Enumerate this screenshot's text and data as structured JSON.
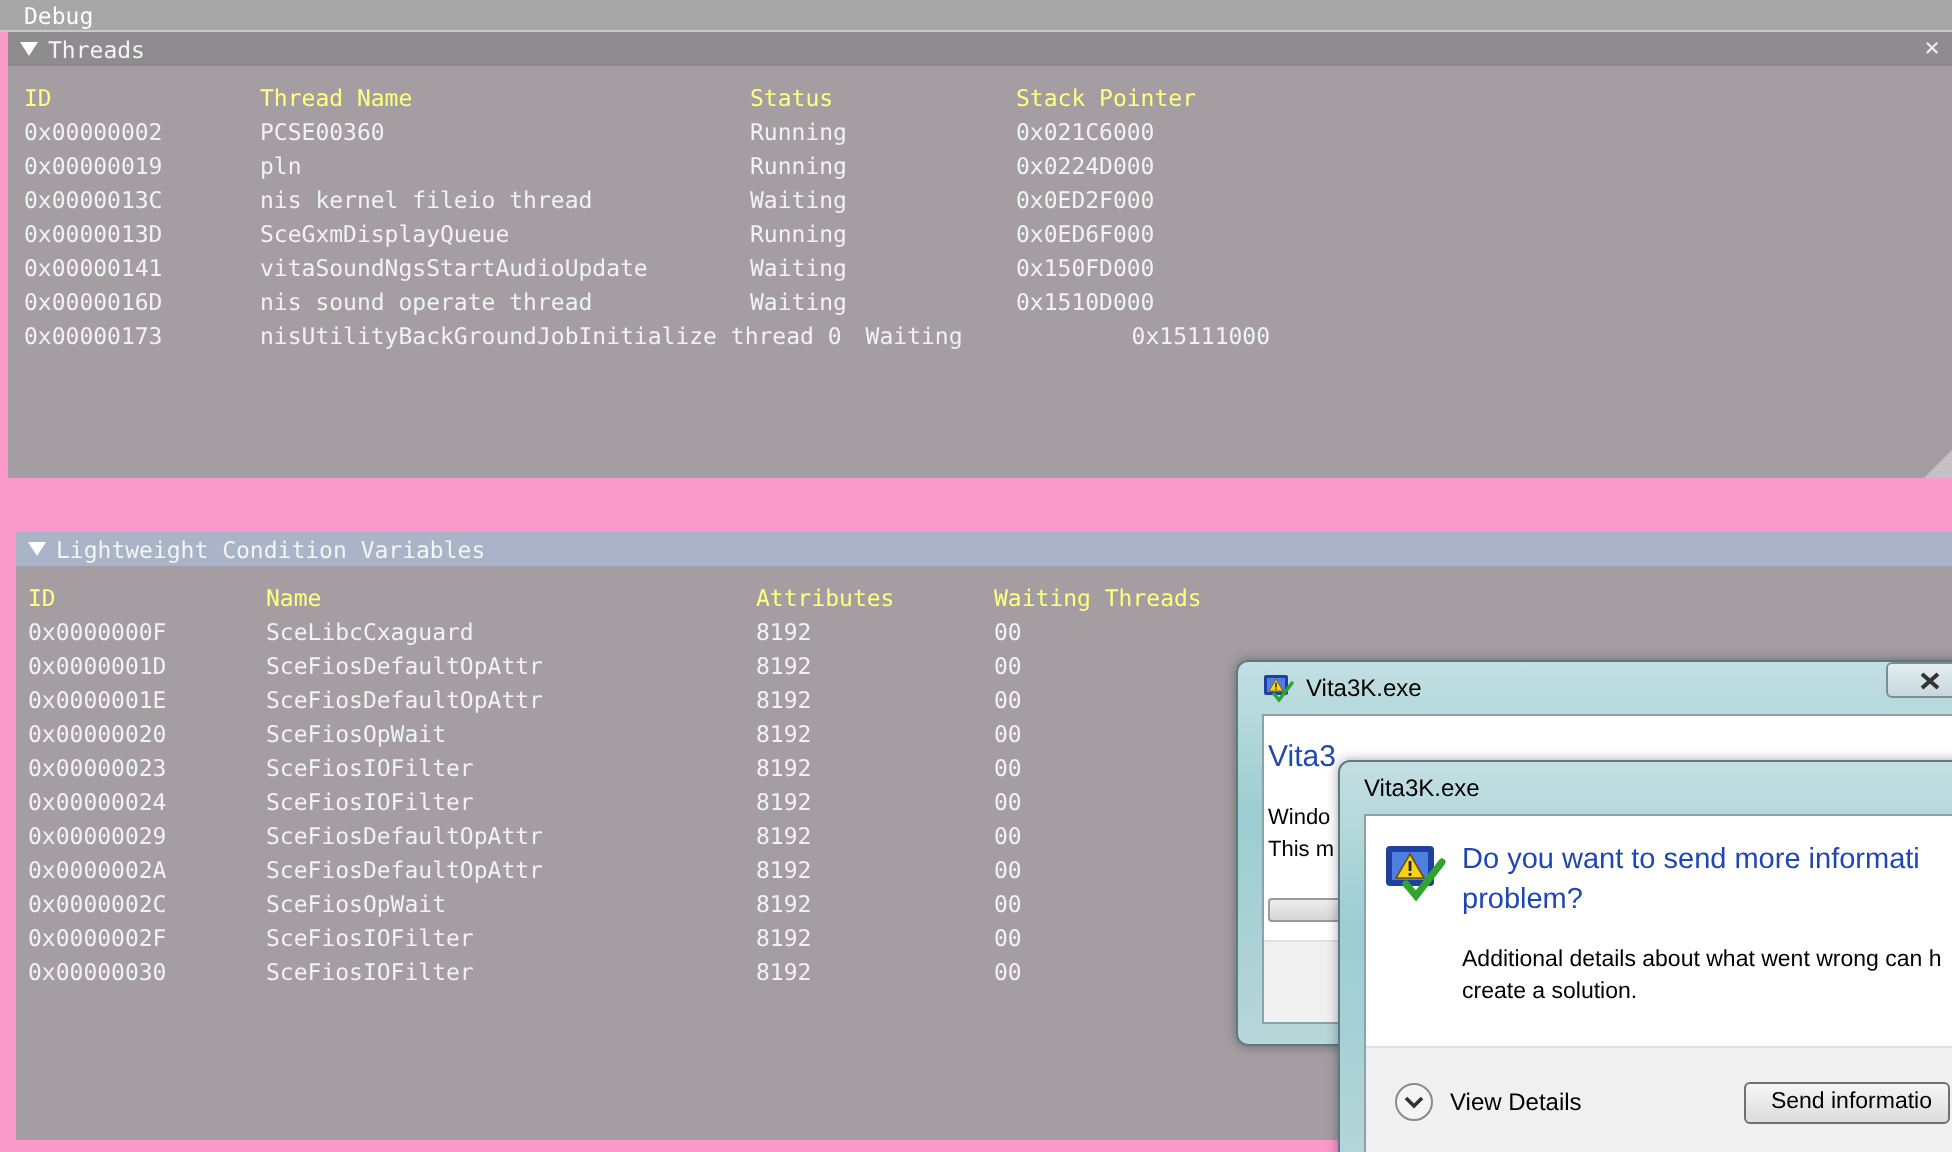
{
  "menu_bar": {
    "items": [
      "Debug"
    ]
  },
  "threads": {
    "title": "Threads",
    "expanded": true,
    "close": "×",
    "columns": [
      "ID",
      "Thread Name",
      "Status",
      "Stack Pointer"
    ],
    "rows": [
      [
        "0x00000002",
        "PCSE00360",
        "Running",
        "0x021C6000"
      ],
      [
        "0x00000019",
        "pln",
        "Running",
        "0x0224D000"
      ],
      [
        "0x0000013C",
        "nis kernel fileio thread",
        "Waiting",
        "0x0ED2F000"
      ],
      [
        "0x0000013D",
        "SceGxmDisplayQueue",
        "Running",
        "0x0ED6F000"
      ],
      [
        "0x00000141",
        "vitaSoundNgsStartAudioUpdate",
        "Waiting",
        "0x150FD000"
      ],
      [
        "0x0000016D",
        "nis sound operate thread",
        "Waiting",
        "0x1510D000"
      ],
      [
        "0x00000173",
        "nisUtilityBackGroundJobInitialize thread 0",
        "Waiting",
        "0x15111000"
      ]
    ]
  },
  "lw_cond_vars": {
    "title": "Lightweight Condition Variables",
    "expanded": true,
    "columns": [
      "ID",
      "Name",
      "Attributes",
      "Waiting Threads"
    ],
    "rows": [
      [
        "0x0000000F",
        "SceLibcCxaguard",
        "8192",
        "00"
      ],
      [
        "0x0000001D",
        "SceFiosDefaultOpAttr",
        "8192",
        "00"
      ],
      [
        "0x0000001E",
        "SceFiosDefaultOpAttr",
        "8192",
        "00"
      ],
      [
        "0x00000020",
        "SceFiosOpWait",
        "8192",
        "00"
      ],
      [
        "0x00000023",
        "SceFiosIOFilter",
        "8192",
        "00"
      ],
      [
        "0x00000024",
        "SceFiosIOFilter",
        "8192",
        "00"
      ],
      [
        "0x00000029",
        "SceFiosDefaultOpAttr",
        "8192",
        "00"
      ],
      [
        "0x0000002A",
        "SceFiosDefaultOpAttr",
        "8192",
        "00"
      ],
      [
        "0x0000002C",
        "SceFiosOpWait",
        "8192",
        "00"
      ],
      [
        "0x0000002F",
        "SceFiosIOFilter",
        "8192",
        "00"
      ],
      [
        "0x00000030",
        "SceFiosIOFilter",
        "8192",
        "00"
      ]
    ]
  },
  "error_dialog_back": {
    "title": "Vita3K.exe",
    "heading": "Vita3",
    "lines": [
      "Windo",
      "This m"
    ],
    "progress": {
      "level": 0
    }
  },
  "error_dialog_front": {
    "title": "Vita3K.exe",
    "heading_lines": [
      "Do you want to send more informati",
      "problem?"
    ],
    "details_lines": [
      "Additional details about what went wrong can h",
      "create a solution."
    ],
    "view_details": "View Details",
    "send_button": "Send informatio"
  }
}
